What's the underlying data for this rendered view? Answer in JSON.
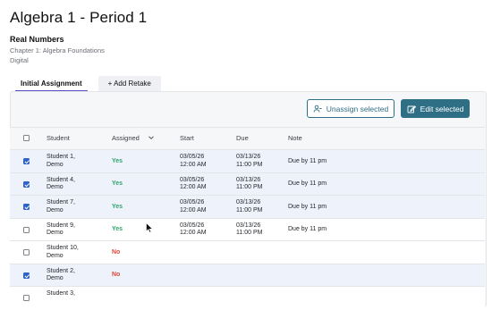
{
  "page": {
    "title": "Algebra 1 - Period 1"
  },
  "unit": {
    "title": "Real Numbers",
    "chapter": "Chapter 1: Algebra Foundations",
    "mode": "Digital"
  },
  "tabs": [
    {
      "label": "Initial Assignment",
      "active": true
    },
    {
      "label": "+ Add Retake",
      "active": false
    }
  ],
  "actions": {
    "unassign_label": "Unassign selected",
    "edit_label": "Edit selected"
  },
  "table": {
    "columns": {
      "student": "Student",
      "assigned": "Assigned",
      "start": "Start",
      "due": "Due",
      "note": "Note"
    },
    "rows": [
      {
        "checked": true,
        "student_line1": "Student 1,",
        "student_line2": "Demo",
        "assigned": "Yes",
        "start_date": "03/05/26",
        "start_time": "12:00 AM",
        "due_date": "03/13/26",
        "due_time": "11:00 PM",
        "note": "Due by 11 pm"
      },
      {
        "checked": true,
        "student_line1": "Student 4,",
        "student_line2": "Demo",
        "assigned": "Yes",
        "start_date": "03/05/26",
        "start_time": "12:00 AM",
        "due_date": "03/13/26",
        "due_time": "11:00 PM",
        "note": "Due by 11 pm"
      },
      {
        "checked": true,
        "student_line1": "Student 7,",
        "student_line2": "Demo",
        "assigned": "Yes",
        "start_date": "03/05/26",
        "start_time": "12:00 AM",
        "due_date": "03/13/26",
        "due_time": "11:00 PM",
        "note": "Due by 11 pm"
      },
      {
        "checked": false,
        "student_line1": "Student 9,",
        "student_line2": "Demo",
        "assigned": "Yes",
        "start_date": "03/05/26",
        "start_time": "12:00 AM",
        "due_date": "03/13/26",
        "due_time": "11:00 PM",
        "note": "Due by 11 pm"
      },
      {
        "checked": false,
        "student_line1": "Student 10,",
        "student_line2": "Demo",
        "assigned": "No",
        "start_date": "",
        "start_time": "",
        "due_date": "",
        "due_time": "",
        "note": ""
      },
      {
        "checked": true,
        "student_line1": "Student 2,",
        "student_line2": "Demo",
        "assigned": "No",
        "start_date": "",
        "start_time": "",
        "due_date": "",
        "due_time": "",
        "note": ""
      },
      {
        "checked": false,
        "student_line1": "Student 3,",
        "student_line2": "",
        "assigned": "",
        "start_date": "",
        "start_time": "",
        "due_date": "",
        "due_time": "",
        "note": ""
      }
    ]
  },
  "colors": {
    "accent": "#2f6f86",
    "selected_row": "#eef2fb",
    "yes": "#2fa66d",
    "no": "#d9483b",
    "checkbox": "#2f62c8"
  }
}
